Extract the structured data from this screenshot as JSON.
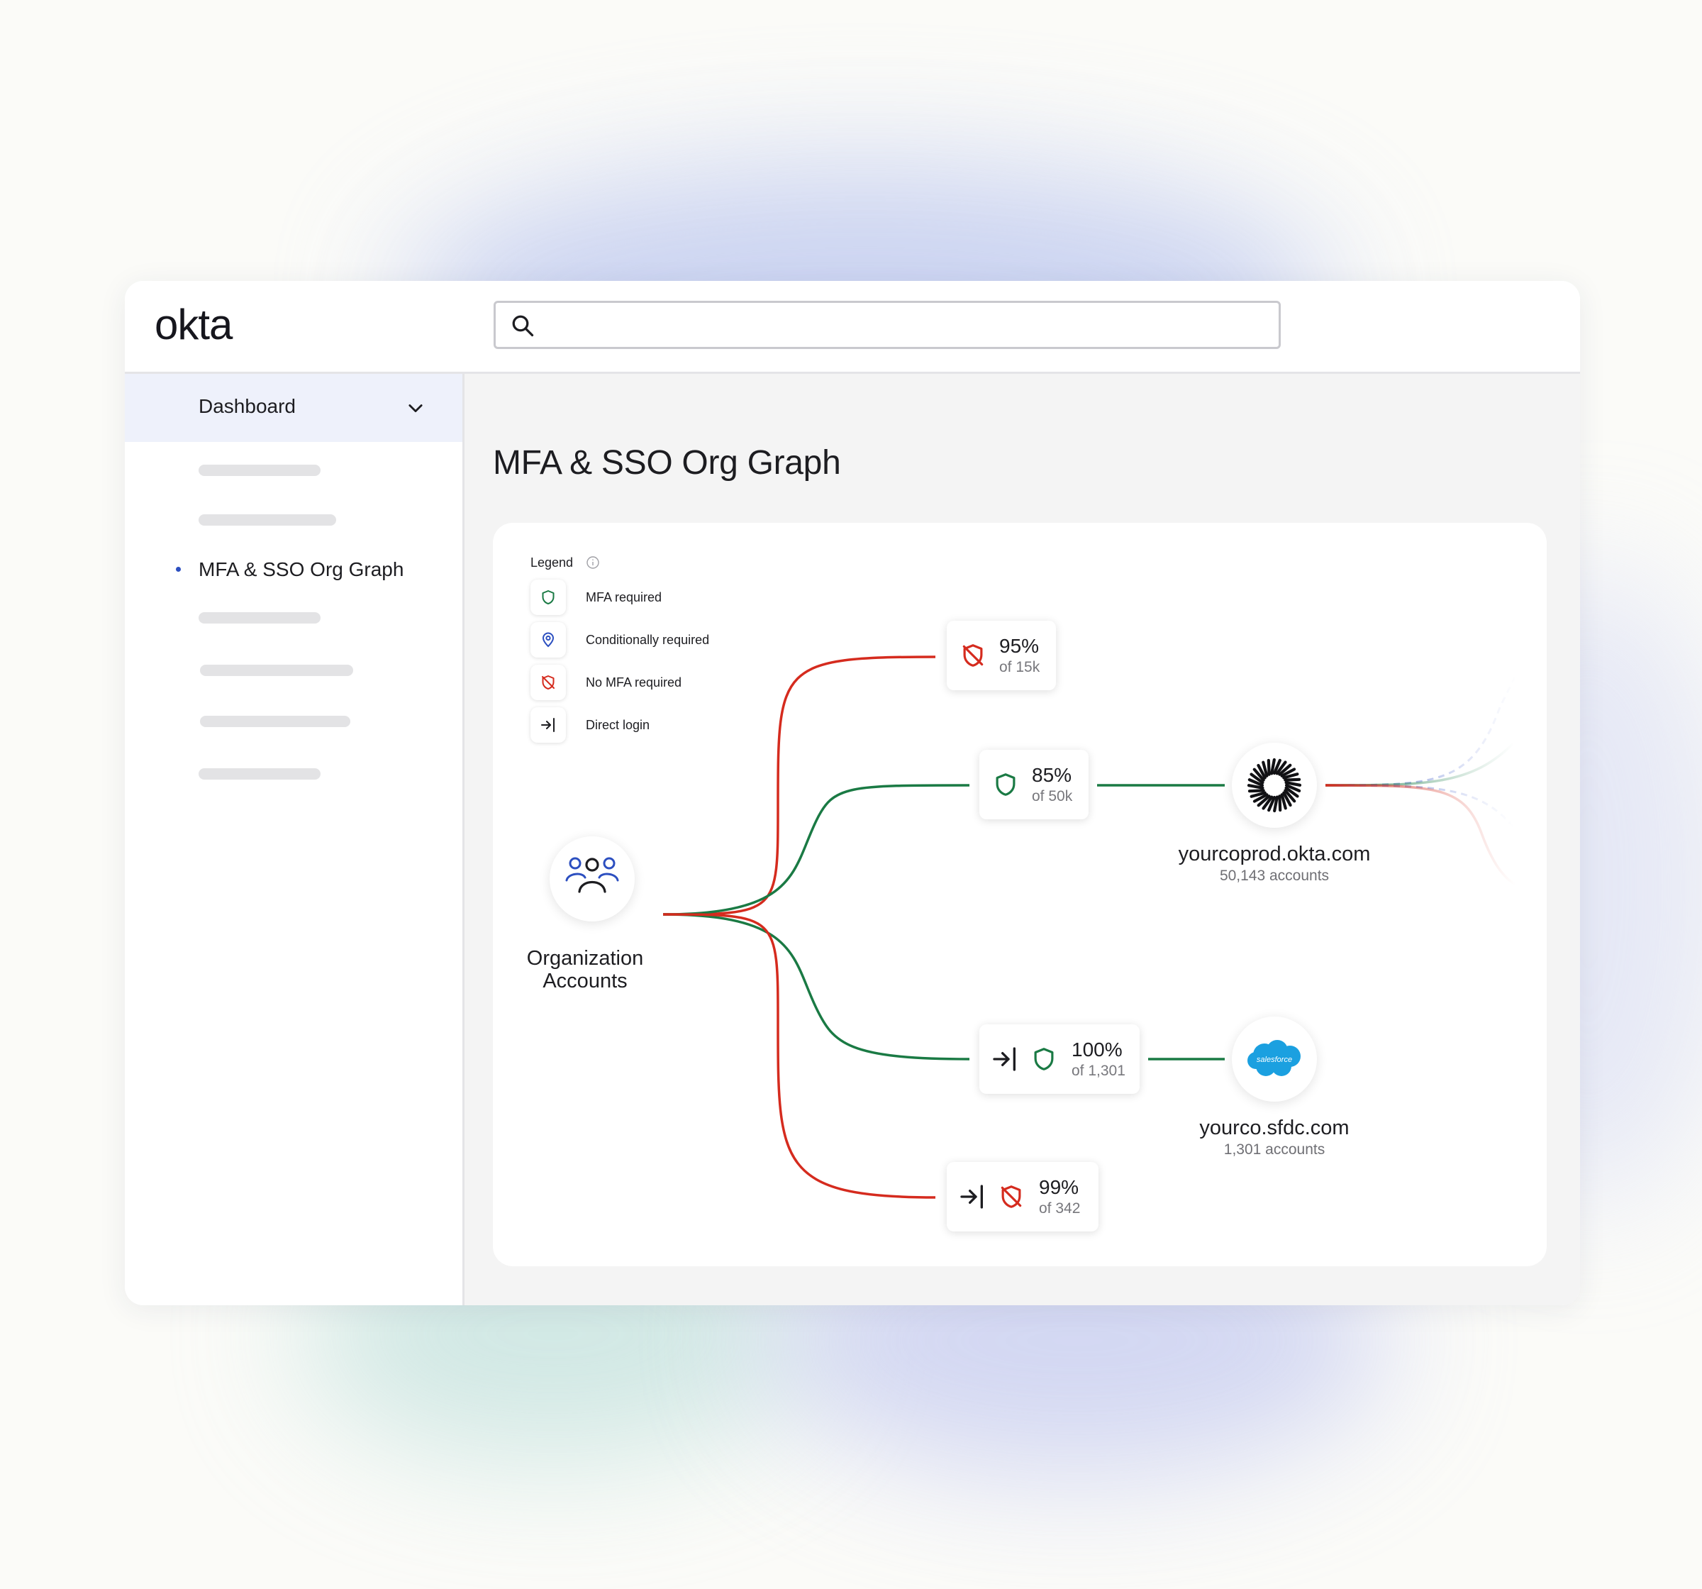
{
  "app": {
    "logo": "okta"
  },
  "search": {
    "value": "",
    "placeholder": ""
  },
  "sidebar": {
    "dashboard_label": "Dashboard",
    "active_item_label": "MFA & SSO Org Graph"
  },
  "page": {
    "title": "MFA & SSO Org Graph"
  },
  "legend": {
    "title": "Legend",
    "items": [
      {
        "icon": "shield-check-icon",
        "label": "MFA required",
        "color": "#1a7a44"
      },
      {
        "icon": "location-pin-icon",
        "label": "Conditionally required",
        "color": "#2c4fc0"
      },
      {
        "icon": "shield-off-icon",
        "label": "No MFA required",
        "color": "#d52b1e"
      },
      {
        "icon": "direct-login-icon",
        "label": "Direct login",
        "color": "#1d1d21"
      }
    ]
  },
  "graph": {
    "source": {
      "name_line1": "Organization",
      "name_line2": "Accounts"
    },
    "flows": [
      {
        "percent": "95%",
        "of": "of 15k",
        "policy": "No MFA required",
        "direct_login": false
      },
      {
        "percent": "85%",
        "of": "of 50k",
        "policy": "MFA required",
        "direct_login": false
      },
      {
        "percent": "100%",
        "of": "of 1,301",
        "policy": "MFA required",
        "direct_login": true
      },
      {
        "percent": "99%",
        "of": "of 342",
        "policy": "No MFA required",
        "direct_login": true
      }
    ],
    "targets": [
      {
        "name": "yourcoprod.okta.com",
        "accounts": "50,143 accounts"
      },
      {
        "name": "yourco.sfdc.com",
        "accounts": "1,301 accounts",
        "logo_text": "salesforce"
      }
    ]
  },
  "colors": {
    "mfa_required": "#1a7a44",
    "conditional": "#2c4fc0",
    "no_mfa": "#d52b1e",
    "salesforce_blue": "#1ba0e0",
    "accent": "#2c4fc0"
  }
}
